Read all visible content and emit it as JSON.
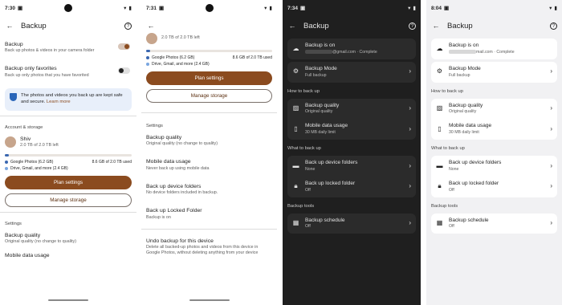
{
  "p1": {
    "status_time": "7:30",
    "title": "Backup",
    "backup": {
      "label": "Backup",
      "sub": "Back up photos & videos in your camera folder"
    },
    "favorites": {
      "label": "Backup only favorites",
      "sub": "Back up only photos that you have favorited"
    },
    "info": {
      "text": "The photos and videos you back up are kept safe and secure.",
      "link": "Learn more"
    },
    "section_account": "Account & storage",
    "account": {
      "name": "Shiv",
      "storage": "2.0 TB of 2.0 TB left"
    },
    "legend": [
      {
        "label": "Google Photos (6.2 GB)",
        "value": "8.6 GB of 2.0 TB used",
        "color": "#3a67b0"
      },
      {
        "label": "Drive, Gmail, and more (2.4 GB)",
        "value": "",
        "color": "#7aa6e0"
      }
    ],
    "plan_btn": "Plan settings",
    "manage_btn": "Manage storage",
    "section_settings": "Settings",
    "quality": {
      "label": "Backup quality",
      "sub": "Original quality (no change to quality)"
    },
    "mobile_partial": "Mobile data usage"
  },
  "p2": {
    "status_time": "7:31",
    "storage": "2.0 TB of 2.0 TB left",
    "legend": [
      {
        "label": "Google Photos (6.2 GB)",
        "value": "8.6 GB of 2.0 TB used",
        "color": "#3a67b0"
      },
      {
        "label": "Drive, Gmail, and more (2.4 GB)",
        "value": "",
        "color": "#7aa6e0"
      }
    ],
    "plan_btn": "Plan settings",
    "manage_btn": "Manage storage",
    "section_settings": "Settings",
    "rows": [
      {
        "label": "Backup quality",
        "sub": "Original quality (no change to quality)"
      },
      {
        "label": "Mobile data usage",
        "sub": "Never back up using mobile data"
      },
      {
        "label": "Back up device folders",
        "sub": "No device folders included in backup."
      },
      {
        "label": "Back up Locked Folder",
        "sub": "Backup is on"
      },
      {
        "label": "Undo backup for this device",
        "sub": "Delete all backed-up photos and videos from this device in Google Photos, without deleting anything from your device"
      }
    ]
  },
  "p3": {
    "status_time": "7:34",
    "title": "Backup",
    "backup_on": {
      "label": "Backup is on",
      "email": "@gmail.com",
      "status": "· Complete"
    },
    "mode": {
      "label": "Backup Mode",
      "sub": "Full backup"
    },
    "section_how": "How to back up",
    "quality": {
      "label": "Backup quality",
      "sub": "Original quality"
    },
    "mobile": {
      "label": "Mobile data usage",
      "sub": "30 MB daily limit"
    },
    "section_what": "What to back up",
    "folders": {
      "label": "Back up device folders",
      "sub": "None"
    },
    "locked": {
      "label": "Back up locked folder",
      "sub": "Off"
    },
    "section_tools": "Backup tools",
    "schedule": {
      "label": "Backup schedule",
      "sub": "Off"
    }
  },
  "p4": {
    "status_time": "8:04",
    "title": "Backup",
    "backup_on": {
      "label": "Backup is on",
      "email": "mail.com",
      "status": "· Complete"
    },
    "mode": {
      "label": "Backup Mode",
      "sub": "Full backup"
    },
    "section_how": "How to back up",
    "quality": {
      "label": "Backup quality",
      "sub": "Original quality"
    },
    "mobile": {
      "label": "Mobile data usage",
      "sub": "30 MB daily limit"
    },
    "section_what": "What to back up",
    "folders": {
      "label": "Back up device folders",
      "sub": "None"
    },
    "locked": {
      "label": "Back up locked folder",
      "sub": "Off"
    },
    "section_tools": "Backup tools",
    "schedule": {
      "label": "Backup schedule",
      "sub": "Off"
    }
  }
}
